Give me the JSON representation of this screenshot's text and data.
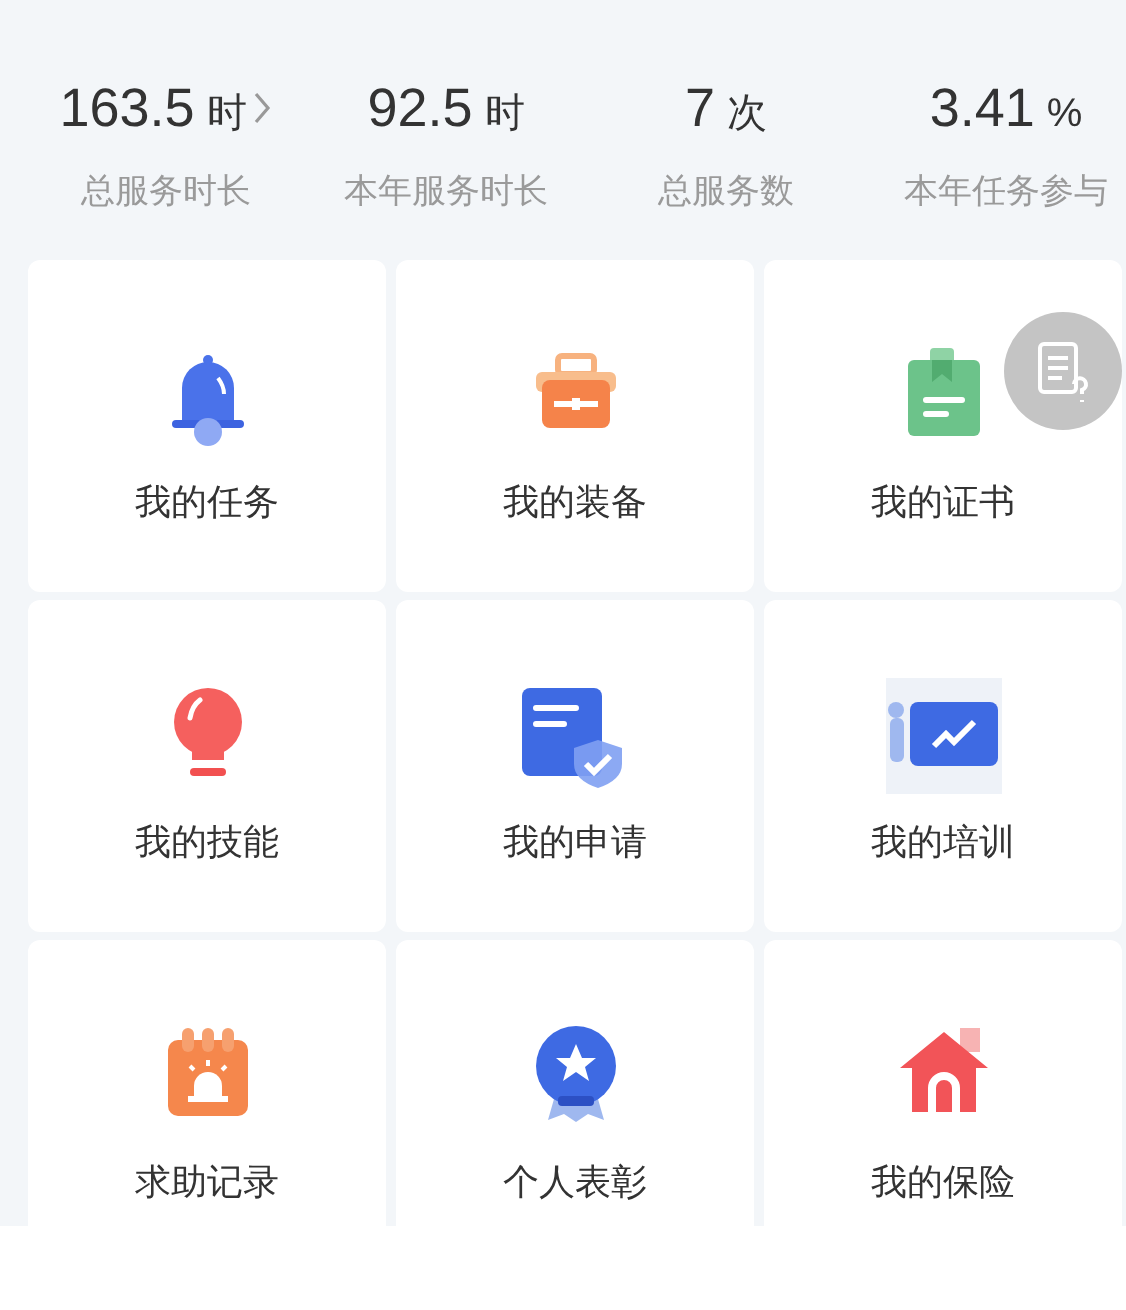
{
  "stats": [
    {
      "value": "163.5",
      "unit": "时",
      "label": "总服务时长",
      "has_arrow": true
    },
    {
      "value": "92.5",
      "unit": "时",
      "label": "本年服务时长",
      "has_arrow": false
    },
    {
      "value": "7",
      "unit": "次",
      "label": "总服务数",
      "has_arrow": false
    },
    {
      "value": "3.41",
      "unit": "%",
      "label": "本年任务参与",
      "has_arrow": false
    }
  ],
  "menu": [
    {
      "label": "我的任务",
      "kind": "bell"
    },
    {
      "label": "我的装备",
      "kind": "toolbox"
    },
    {
      "label": "我的证书",
      "kind": "certificate"
    },
    {
      "label": "我的技能",
      "kind": "bulb"
    },
    {
      "label": "我的申请",
      "kind": "application"
    },
    {
      "label": "我的培训",
      "kind": "training"
    },
    {
      "label": "求助记录",
      "kind": "alarm"
    },
    {
      "label": "个人表彰",
      "kind": "medal"
    },
    {
      "label": "我的保险",
      "kind": "house"
    }
  ]
}
